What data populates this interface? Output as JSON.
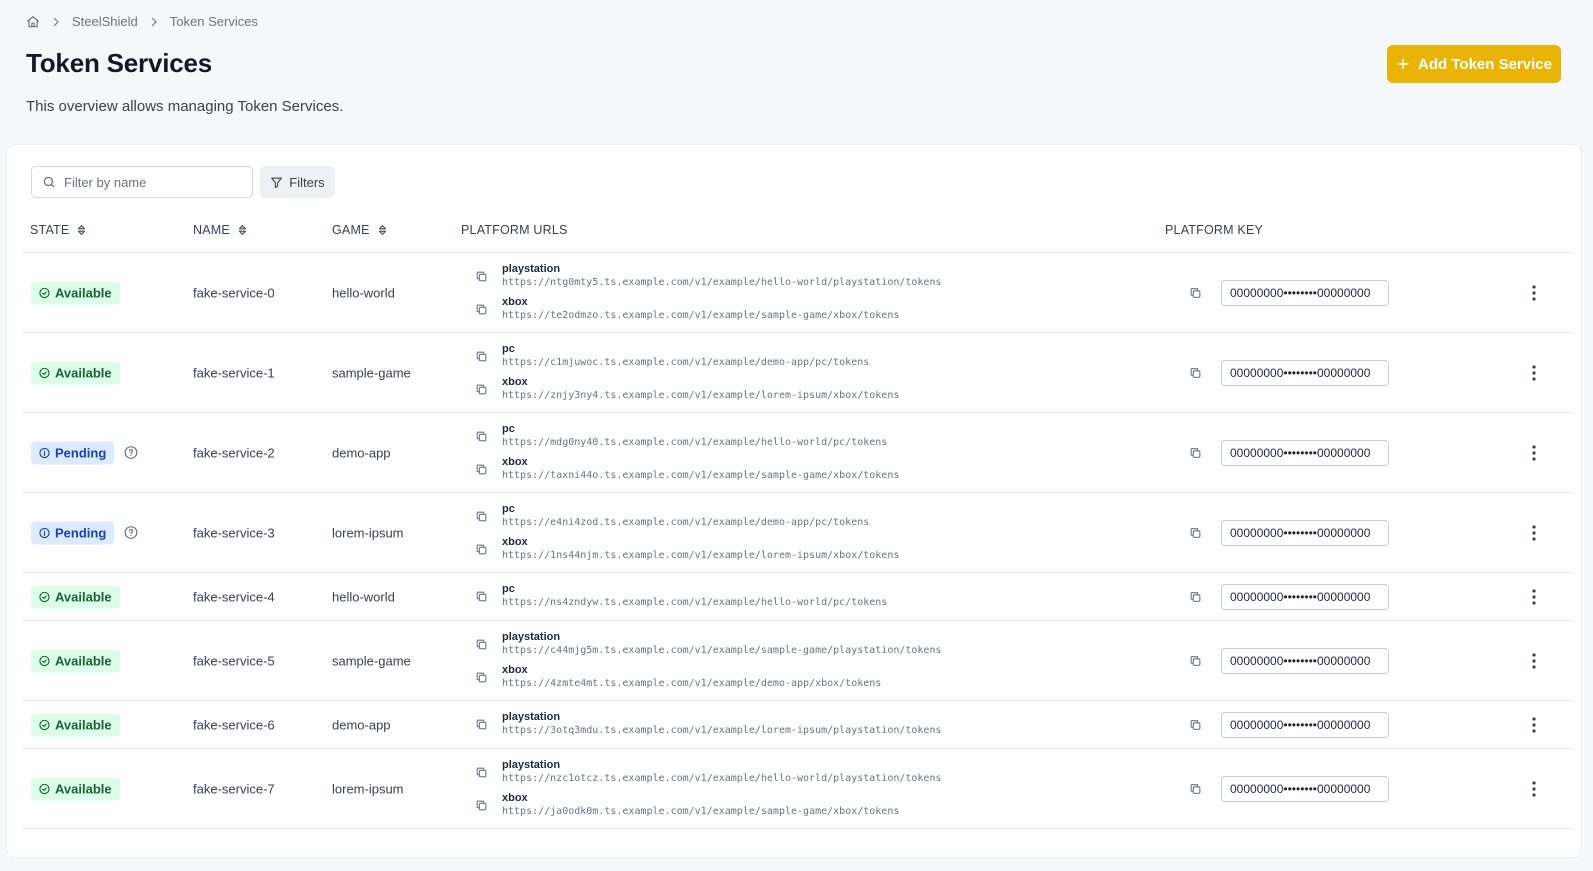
{
  "breadcrumb": {
    "items": [
      "SteelShield",
      "Token Services"
    ]
  },
  "page": {
    "title": "Token Services",
    "description": "This overview allows managing Token Services.",
    "add_button": "Add Token Service"
  },
  "toolbar": {
    "search_placeholder": "Filter by name",
    "filters_label": "Filters"
  },
  "columns": {
    "state": "STATE",
    "name": "NAME",
    "game": "GAME",
    "urls": "PLATFORM URLS",
    "key": "PLATFORM KEY"
  },
  "colors": {
    "accent": "#eab308",
    "available_bg": "#dcfce7",
    "available_fg": "#166534",
    "pending_bg": "#dbeafe",
    "pending_fg": "#1e40af"
  },
  "rows": [
    {
      "state": "Available",
      "name": "fake-service-0",
      "game": "hello-world",
      "key": "00000000••••••••00000000",
      "urls": [
        {
          "platform": "playstation",
          "url": "https://ntg0mty5.ts.example.com/v1/example/hello-world/playstation/tokens"
        },
        {
          "platform": "xbox",
          "url": "https://te2odmzo.ts.example.com/v1/example/sample-game/xbox/tokens"
        }
      ]
    },
    {
      "state": "Available",
      "name": "fake-service-1",
      "game": "sample-game",
      "key": "00000000••••••••00000000",
      "urls": [
        {
          "platform": "pc",
          "url": "https://c1mjuwoc.ts.example.com/v1/example/demo-app/pc/tokens"
        },
        {
          "platform": "xbox",
          "url": "https://znjy3ny4.ts.example.com/v1/example/lorem-ipsum/xbox/tokens"
        }
      ]
    },
    {
      "state": "Pending",
      "name": "fake-service-2",
      "game": "demo-app",
      "key": "00000000••••••••00000000",
      "urls": [
        {
          "platform": "pc",
          "url": "https://mdg0ny40.ts.example.com/v1/example/hello-world/pc/tokens"
        },
        {
          "platform": "xbox",
          "url": "https://taxni44o.ts.example.com/v1/example/sample-game/xbox/tokens"
        }
      ]
    },
    {
      "state": "Pending",
      "name": "fake-service-3",
      "game": "lorem-ipsum",
      "key": "00000000••••••••00000000",
      "urls": [
        {
          "platform": "pc",
          "url": "https://e4ni4zod.ts.example.com/v1/example/demo-app/pc/tokens"
        },
        {
          "platform": "xbox",
          "url": "https://1ns44njm.ts.example.com/v1/example/lorem-ipsum/xbox/tokens"
        }
      ]
    },
    {
      "state": "Available",
      "name": "fake-service-4",
      "game": "hello-world",
      "key": "00000000••••••••00000000",
      "urls": [
        {
          "platform": "pc",
          "url": "https://ns4zndyw.ts.example.com/v1/example/hello-world/pc/tokens"
        }
      ]
    },
    {
      "state": "Available",
      "name": "fake-service-5",
      "game": "sample-game",
      "key": "00000000••••••••00000000",
      "urls": [
        {
          "platform": "playstation",
          "url": "https://c44mjg5m.ts.example.com/v1/example/sample-game/playstation/tokens"
        },
        {
          "platform": "xbox",
          "url": "https://4zmte4mt.ts.example.com/v1/example/demo-app/xbox/tokens"
        }
      ]
    },
    {
      "state": "Available",
      "name": "fake-service-6",
      "game": "demo-app",
      "key": "00000000••••••••00000000",
      "urls": [
        {
          "platform": "playstation",
          "url": "https://3otq3mdu.ts.example.com/v1/example/lorem-ipsum/playstation/tokens"
        }
      ]
    },
    {
      "state": "Available",
      "name": "fake-service-7",
      "game": "lorem-ipsum",
      "key": "00000000••••••••00000000",
      "urls": [
        {
          "platform": "playstation",
          "url": "https://nzc1otcz.ts.example.com/v1/example/hello-world/playstation/tokens"
        },
        {
          "platform": "xbox",
          "url": "https://ja0odk0m.ts.example.com/v1/example/sample-game/xbox/tokens"
        }
      ]
    }
  ]
}
